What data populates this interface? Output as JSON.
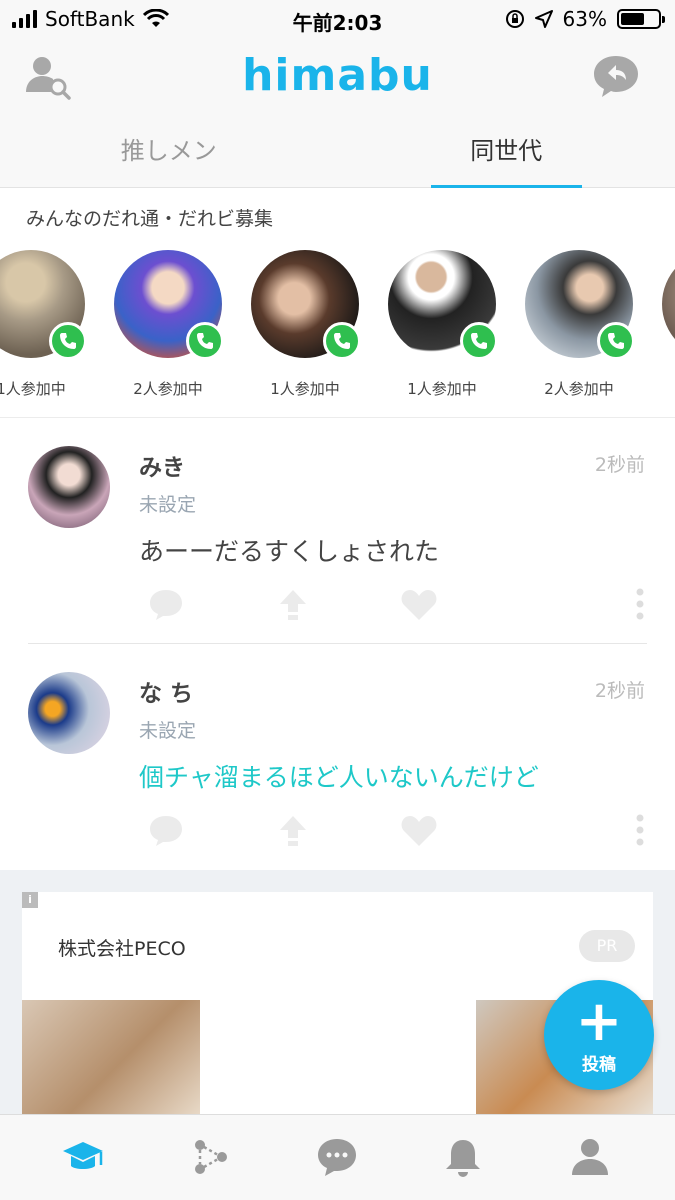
{
  "status_bar": {
    "carrier": "SoftBank",
    "time": "午前2:03",
    "battery": "63%",
    "battery_level": 0.63,
    "icons": [
      "signal-icon",
      "wifi-icon",
      "rotation-lock-icon",
      "location-icon",
      "battery-icon"
    ]
  },
  "header": {
    "logo": "himabu",
    "left_icon": "user-search-icon",
    "right_icon": "chat-reply-icon",
    "accent_color": "#1ab4ea"
  },
  "tabs": [
    {
      "label": "推しメン",
      "active": false
    },
    {
      "label": "同世代",
      "active": true
    }
  ],
  "rooms": {
    "title": "みんなのだれ通・だれビ募集",
    "items": [
      {
        "count": "1人参加中"
      },
      {
        "count": "2人参加中"
      },
      {
        "count": "1人参加中"
      },
      {
        "count": "1人参加中"
      },
      {
        "count": "2人参加中"
      }
    ]
  },
  "posts": [
    {
      "name": "みき",
      "sub": "未設定",
      "text": "あーーだるすくしょされた",
      "time": "2秒前"
    },
    {
      "name": "な ち",
      "sub": "未設定",
      "text": "個チャ溜まるほど人いないんだけど",
      "time": "2秒前"
    }
  ],
  "ad": {
    "info": "i",
    "advertiser": "株式会社PECO",
    "badge": "PR"
  },
  "fab": {
    "plus": "+",
    "label": "投稿"
  },
  "bottom_nav": [
    "graduation-cap-icon",
    "network-icon",
    "chat-bubble-icon",
    "bell-icon",
    "profile-icon"
  ]
}
